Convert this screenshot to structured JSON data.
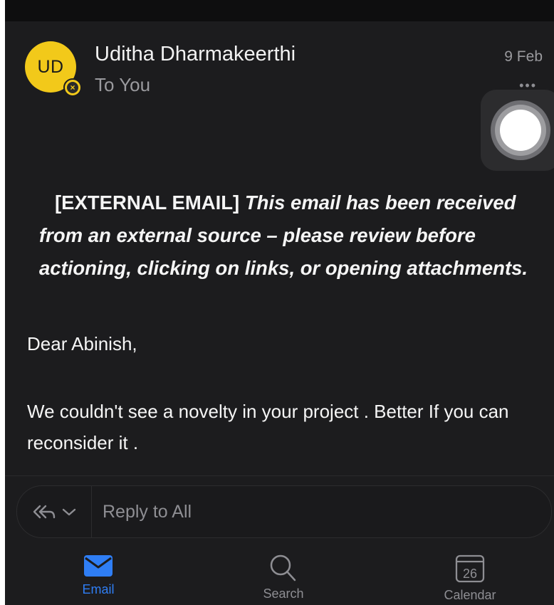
{
  "message": {
    "sender_initials": "UD",
    "sender_name": "Uditha Dharmakeerthi",
    "recipient": "To You",
    "date": "9 Feb",
    "more_label": "•••",
    "warning_tag": "[EXTERNAL EMAIL]",
    "warning_text": "This email has been received from an external source – please review before actioning, clicking on links, or opening attachments.",
    "greeting": "Dear Abinish,",
    "body": " We couldn't see a novelty in your project . Better If you can reconsider it ."
  },
  "reply": {
    "placeholder": "Reply to All",
    "reply_all_icon": "reply-all-icon",
    "chevron_icon": "chevron-down-icon"
  },
  "tabs": [
    {
      "label": "Email",
      "icon": "mail-icon",
      "active": true
    },
    {
      "label": "Search",
      "icon": "search-icon",
      "active": false
    },
    {
      "label": "Calendar",
      "icon": "calendar-icon",
      "day": "26",
      "active": false
    }
  ],
  "colors": {
    "background": "#1c1c1e",
    "avatar": "#f2c91a",
    "accent": "#2f7ef5",
    "text": "#f5f5f5",
    "muted": "#9a9a9e"
  }
}
